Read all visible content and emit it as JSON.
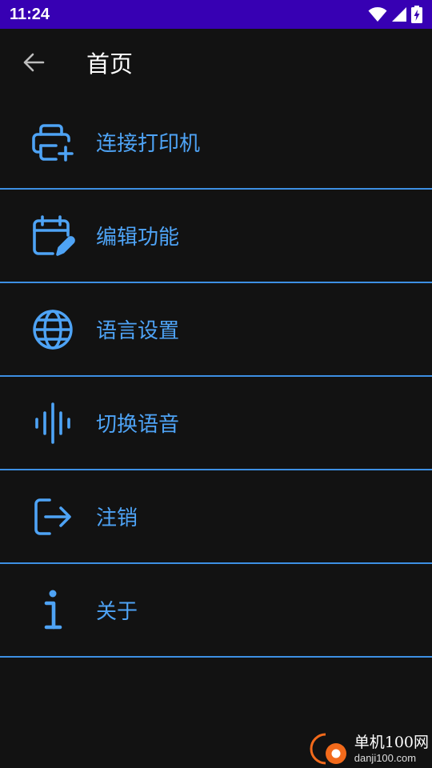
{
  "status_bar": {
    "time": "11:24",
    "icons": [
      "wifi-icon",
      "signal-icon",
      "battery-charging-icon"
    ]
  },
  "app_bar": {
    "back_icon": "arrow-left-icon",
    "title": "首页"
  },
  "menu": {
    "items": [
      {
        "label": "连接打印机",
        "icon": "printer-add-icon"
      },
      {
        "label": "编辑功能",
        "icon": "calendar-edit-icon"
      },
      {
        "label": "语言设置",
        "icon": "globe-icon"
      },
      {
        "label": "切换语音",
        "icon": "audio-wave-icon"
      },
      {
        "label": "注销",
        "icon": "logout-icon"
      },
      {
        "label": "关于",
        "icon": "info-icon"
      }
    ]
  },
  "watermark": {
    "title": "单机100网",
    "url": "danji100.com"
  },
  "colors": {
    "background": "#121212",
    "status_bar": "#3700b3",
    "accent": "#4ea3f5",
    "divider": "#3d8fe3"
  }
}
